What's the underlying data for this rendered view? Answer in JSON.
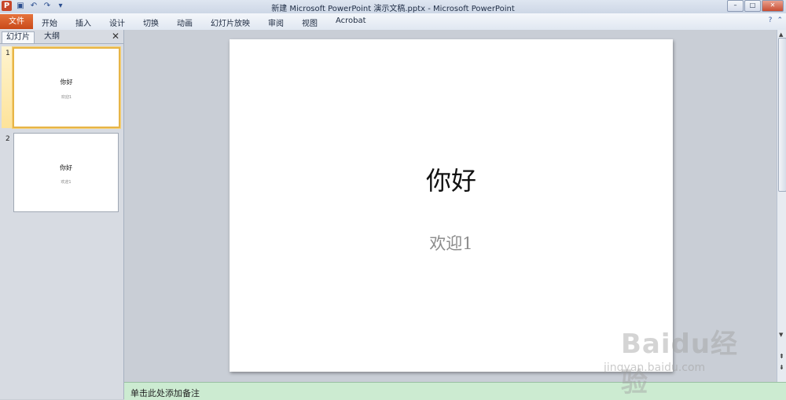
{
  "window": {
    "title": "新建 Microsoft PowerPoint 演示文稿.pptx - Microsoft PowerPoint",
    "app_icon_letter": "P",
    "buttons": [
      "–",
      "□",
      "✕"
    ]
  },
  "quick_access": [
    "save-icon",
    "undo-icon",
    "redo-icon",
    "customize-icon"
  ],
  "ribbon": {
    "file_tab": "文件",
    "tabs": [
      "开始",
      "插入",
      "设计",
      "切换",
      "动画",
      "幻灯片放映",
      "审阅",
      "视图",
      "Acrobat"
    ]
  },
  "left_panel": {
    "tabs": [
      "幻灯片",
      "大纲"
    ],
    "close": "✕",
    "slides": [
      {
        "number": "1",
        "title": "你好",
        "subtitle": "欢迎1"
      },
      {
        "number": "2",
        "title": "你好",
        "subtitle": "欢迎1"
      }
    ]
  },
  "slide": {
    "title": "你好",
    "subtitle": "欢迎1"
  },
  "notes": {
    "placeholder": "单击此处添加备注"
  },
  "watermark": {
    "main": "Baidu经验",
    "url": "jingyan.baidu.com"
  }
}
